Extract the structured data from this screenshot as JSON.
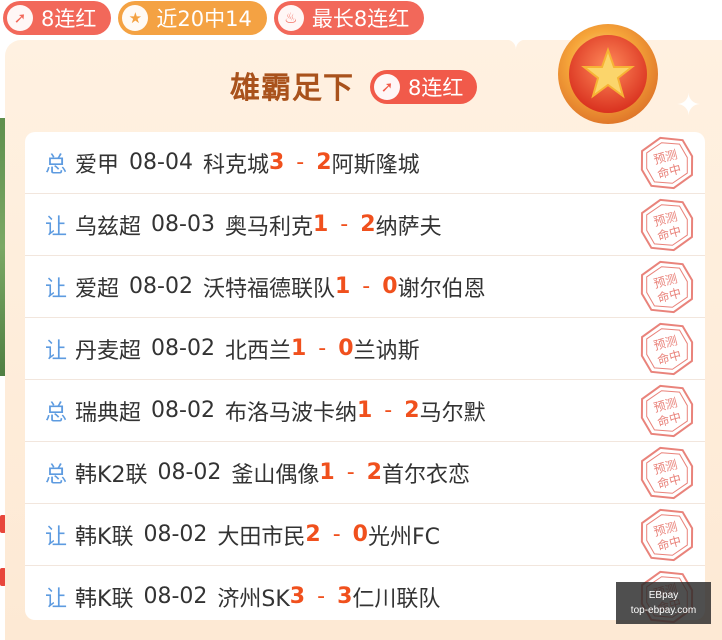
{
  "colors": {
    "accent_red": "#f15a4a",
    "accent_orange": "#f4a243",
    "score": "#f0501d",
    "type_blue": "#5d9be0",
    "title_brown": "#a9521c"
  },
  "tags": [
    {
      "icon": "arrow-up-icon",
      "label": "8连红"
    },
    {
      "icon": "star-icon",
      "label": "近20中14"
    },
    {
      "icon": "flame-icon",
      "label": "最长8连红"
    }
  ],
  "card": {
    "title": "雄霸足下",
    "badge": "8连红"
  },
  "matches": [
    {
      "type": "总",
      "league": "爱甲",
      "date": "08-04",
      "home": "科克城",
      "home_score": "3",
      "away_score": "2",
      "away": "阿斯隆城"
    },
    {
      "type": "让",
      "league": "乌兹超",
      "date": "08-03",
      "home": "奥马利克",
      "home_score": "1",
      "away_score": "2",
      "away": "纳萨夫"
    },
    {
      "type": "让",
      "league": "爱超",
      "date": "08-02",
      "home": "沃特福德联队",
      "home_score": "1",
      "away_score": "0",
      "away": "谢尔伯恩"
    },
    {
      "type": "让",
      "league": "丹麦超",
      "date": "08-02",
      "home": "北西兰",
      "home_score": "1",
      "away_score": "0",
      "away": "兰讷斯"
    },
    {
      "type": "总",
      "league": "瑞典超",
      "date": "08-02",
      "home": "布洛马波卡纳",
      "home_score": "1",
      "away_score": "2",
      "away": "马尔默"
    },
    {
      "type": "总",
      "league": "韩K2联",
      "date": "08-02",
      "home": "釜山偶像",
      "home_score": "1",
      "away_score": "2",
      "away": "首尔衣恋"
    },
    {
      "type": "让",
      "league": "韩K联",
      "date": "08-02",
      "home": "大田市民",
      "home_score": "2",
      "away_score": "0",
      "away": "光州FC"
    },
    {
      "type": "让",
      "league": "韩K联",
      "date": "08-02",
      "home": "济州SK",
      "home_score": "3",
      "away_score": "3",
      "away": "仁川联队"
    }
  ],
  "stamp": {
    "line1": "预测",
    "line2": "命中"
  },
  "watermark": {
    "line1": "EBpay",
    "line2": "top-ebpay.com"
  }
}
